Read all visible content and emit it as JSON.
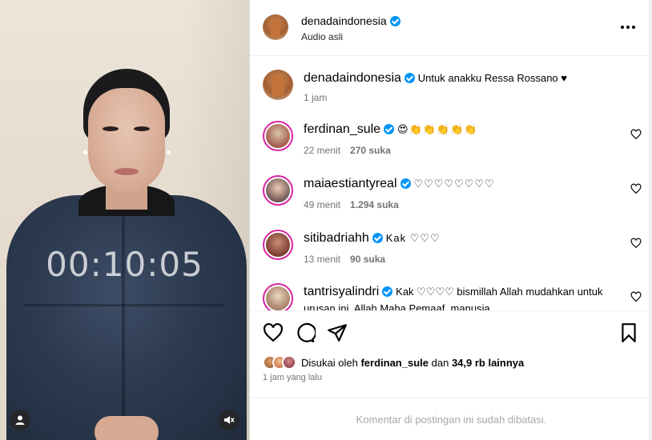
{
  "video": {
    "timer": "00:10:05",
    "icons": {
      "user": "user-icon",
      "mute": "muted-speaker-icon"
    }
  },
  "header": {
    "username": "denadaindonesia",
    "subtitle": "Audio asli",
    "more_icon": "more-horizontal-icon"
  },
  "caption": {
    "username": "denadaindonesia",
    "text": "Untuk anakku Ressa Rossano ♥",
    "time": "1 jam"
  },
  "comments": [
    {
      "username": "ferdinan_sule",
      "text": "😍👏👏👏👏👏",
      "time": "22 menit",
      "likes": "270 suka"
    },
    {
      "username": "maiaestiantyreal",
      "text": "♡♡♡♡♡♡♡♡",
      "time": "49 menit",
      "likes": "1.294 suka"
    },
    {
      "username": "sitibadriahh",
      "text": "Kak ♡♡♡",
      "time": "13 menit",
      "likes": "90 suka"
    },
    {
      "username": "tantrisyalindri",
      "text": "Kak ♡♡♡♡  bismillah Allah mudahkan untuk urusan ini. Allah Maha Pemaaf, manusia",
      "time": "",
      "likes": ""
    }
  ],
  "actions": {
    "like_icon": "heart-icon",
    "comment_icon": "comment-icon",
    "share_icon": "send-icon",
    "save_icon": "bookmark-icon"
  },
  "likes": {
    "prefix": "Disukai oleh",
    "name": "ferdinan_sule",
    "middle": "dan",
    "count": "34,9 rb lainnya"
  },
  "posted": "1 jam yang lalu",
  "footer": "Komentar di postingan ini sudah dibatasi.",
  "colors": {
    "verified": "#0095f6",
    "muted_text": "#737373",
    "ring": "#d6249f"
  }
}
